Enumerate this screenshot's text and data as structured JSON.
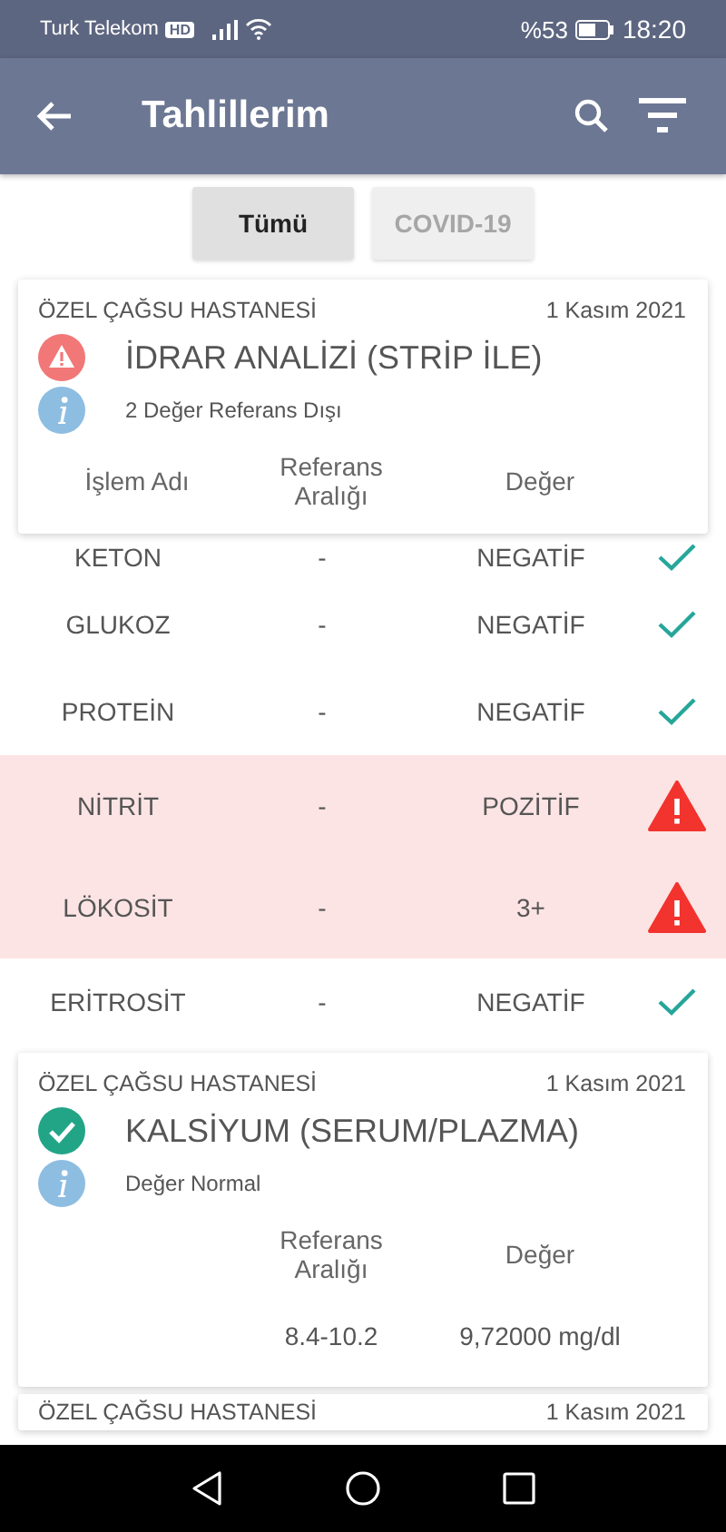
{
  "status_bar": {
    "carrier": "Turk Telekom",
    "network_badge": "HD",
    "battery": "%53",
    "time": "18:20"
  },
  "app_bar": {
    "title": "Tahlillerim"
  },
  "tabs": [
    {
      "label": "Tümü",
      "selected": true
    },
    {
      "label": "COVID-19",
      "selected": false
    }
  ],
  "results": [
    {
      "hospital": "ÖZEL ÇAĞSU HASTANESİ",
      "date": "1 Kasım 2021",
      "title": "İDRAR ANALİZİ (STRİP İLE)",
      "kind": "warning",
      "info": "2 Değer Referans Dışı",
      "columns": [
        "İşlem Adı",
        "Referans Aralığı",
        "Değer"
      ],
      "rows": [
        {
          "name": "KETON",
          "range": "-",
          "value": "NEGATİF",
          "abnormal": false
        },
        {
          "name": "GLUKOZ",
          "range": "-",
          "value": "NEGATİF",
          "abnormal": false
        },
        {
          "name": "PROTEİN",
          "range": "-",
          "value": "NEGATİF",
          "abnormal": false
        },
        {
          "name": "NİTRİT",
          "range": "-",
          "value": "POZİTİF",
          "abnormal": true
        },
        {
          "name": "LÖKOSİT",
          "range": "-",
          "value": "3+",
          "abnormal": true
        },
        {
          "name": "ERİTROSİT",
          "range": "-",
          "value": "NEGATİF",
          "abnormal": false
        }
      ]
    },
    {
      "hospital": "ÖZEL ÇAĞSU HASTANESİ",
      "date": "1 Kasım 2021",
      "title": "KALSİYUM (SERUM/PLAZMA)",
      "kind": "ok",
      "info": "Değer Normal",
      "columns": [
        "Referans Aralığı",
        "Değer"
      ],
      "rows": [
        {
          "range": "8.4-10.2",
          "value": "9,72000 mg/dl"
        }
      ]
    },
    {
      "hospital": "ÖZEL ÇAĞSU HASTANESİ",
      "date": "1 Kasım 2021"
    }
  ]
}
